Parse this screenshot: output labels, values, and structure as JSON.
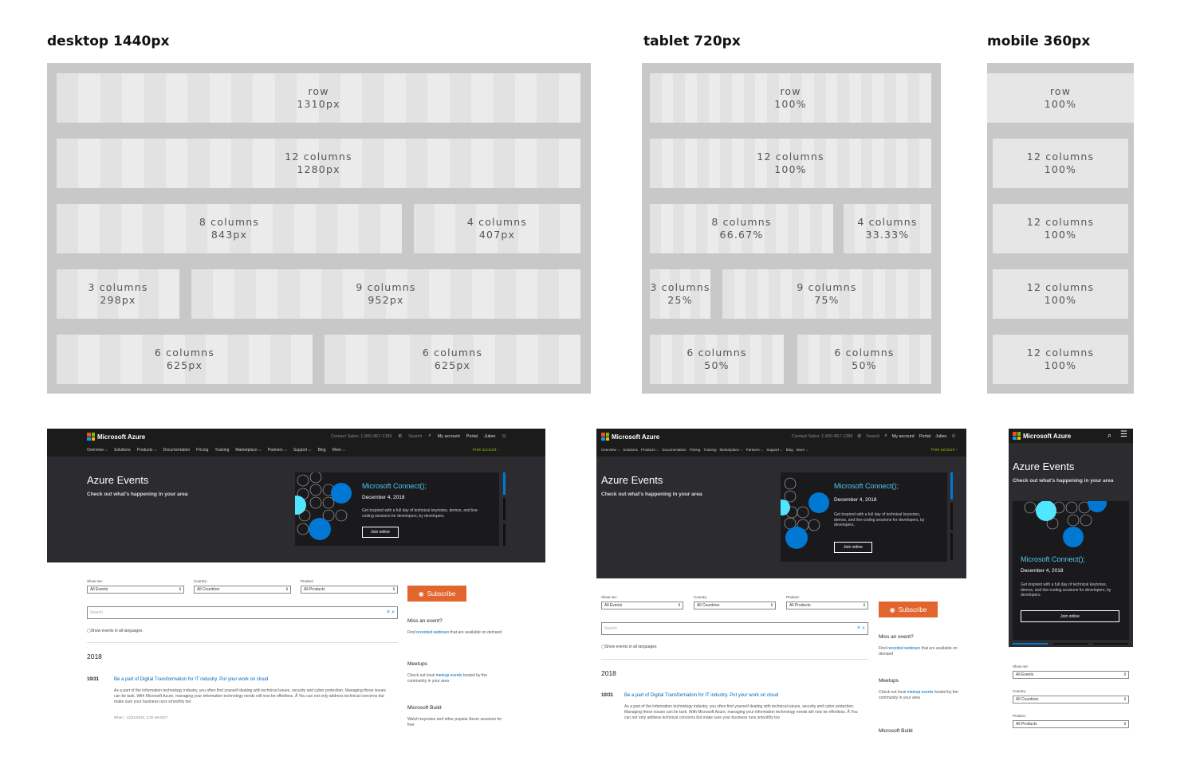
{
  "headings": {
    "desktop": "desktop 1440px",
    "tablet": "tablet 720px",
    "mobile": "mobile 360px"
  },
  "grids": {
    "desktop": [
      {
        "name": "row",
        "size": "1310px"
      },
      {
        "name": "12 columns",
        "size": "1280px"
      },
      {
        "name": "8 columns",
        "size": "843px"
      },
      {
        "name": "4 columns",
        "size": "407px"
      },
      {
        "name": "3 columns",
        "size": "298px"
      },
      {
        "name": "9 columns",
        "size": "952px"
      },
      {
        "name": "6 columns",
        "size": "625px"
      },
      {
        "name": "6 columns",
        "size": "625px"
      }
    ],
    "tablet": [
      {
        "name": "row",
        "size": "100%"
      },
      {
        "name": "12 columns",
        "size": "100%"
      },
      {
        "name": "8 columns",
        "size": "66.67%"
      },
      {
        "name": "4 columns",
        "size": "33.33%"
      },
      {
        "name": "3 columns",
        "size": "25%"
      },
      {
        "name": "9 columns",
        "size": "75%"
      },
      {
        "name": "6 columns",
        "size": "50%"
      },
      {
        "name": "6 columns",
        "size": "50%"
      }
    ],
    "mobile": [
      {
        "name": "row",
        "size": "100%"
      },
      {
        "name": "12 columns",
        "size": "100%"
      },
      {
        "name": "12 columns",
        "size": "100%"
      },
      {
        "name": "12 columns",
        "size": "100%"
      },
      {
        "name": "12 columns",
        "size": "100%"
      }
    ]
  },
  "site": {
    "brand": "Microsoft Azure",
    "contact_desktop": "Contact Sales: 1-800-867-1389",
    "contact_tablet": "Contact Sales: 1-800-867-1389",
    "search": "Search",
    "my_account": "My account",
    "portal": "Portal",
    "user": "Julien",
    "nav": [
      "Overview ⌵",
      "Solutions",
      "Products ⌵",
      "Documentation",
      "Pricing",
      "Training",
      "Marketplace ⌵",
      "Partners ⌵",
      "Support ⌵",
      "Blog",
      "More ⌵"
    ],
    "free_account": "Free account ›",
    "hero_title": "Azure Events",
    "hero_sub": "Check out what's happening in your area",
    "card_title": "Microsoft Connect();",
    "card_date": "December 4, 2018",
    "card_desc": "Get inspired with a full day of technical keynotes, demos, and live-coding sessions for developers, by developers.",
    "card_button": "Join online",
    "label_show": "Show me:",
    "label_country": "Country:",
    "label_product": "Product:",
    "select_show": "All Events",
    "select_country": "All Countries",
    "select_product": "All Products",
    "search_placeholder": "Search",
    "show_all_languages": "Show events in all languages",
    "year": "2018",
    "event_date": "10/31",
    "event_title": "Be a part of Digital Transformation for IT industry. Put your work on cloud",
    "event_desc": "As a part of the information technology industry, you often find yourself dealing with technical issues, security and cyber protection. Managing these issues can be task. With Microsoft Azure, managing your information technology needs will now be effortless. Â You can not only address technical concerns but make sure your business runs smoothly too",
    "event_when": "When : 10/31/2018, 2:30 AM EDT",
    "subscribe": "Subscribe",
    "miss_title": "Miss an event?",
    "miss_pre": "Find ",
    "miss_link": "recorded webinars",
    "miss_post": " that are available on demand",
    "meetups_title": "Meetups",
    "meetups_pre": "Check out local ",
    "meetups_link": "meetup events",
    "meetups_post": " hosted by the community in your area",
    "build_title": "Microsoft Build",
    "build_text": "Watch keynotes and other popular Azure sessions for free"
  }
}
